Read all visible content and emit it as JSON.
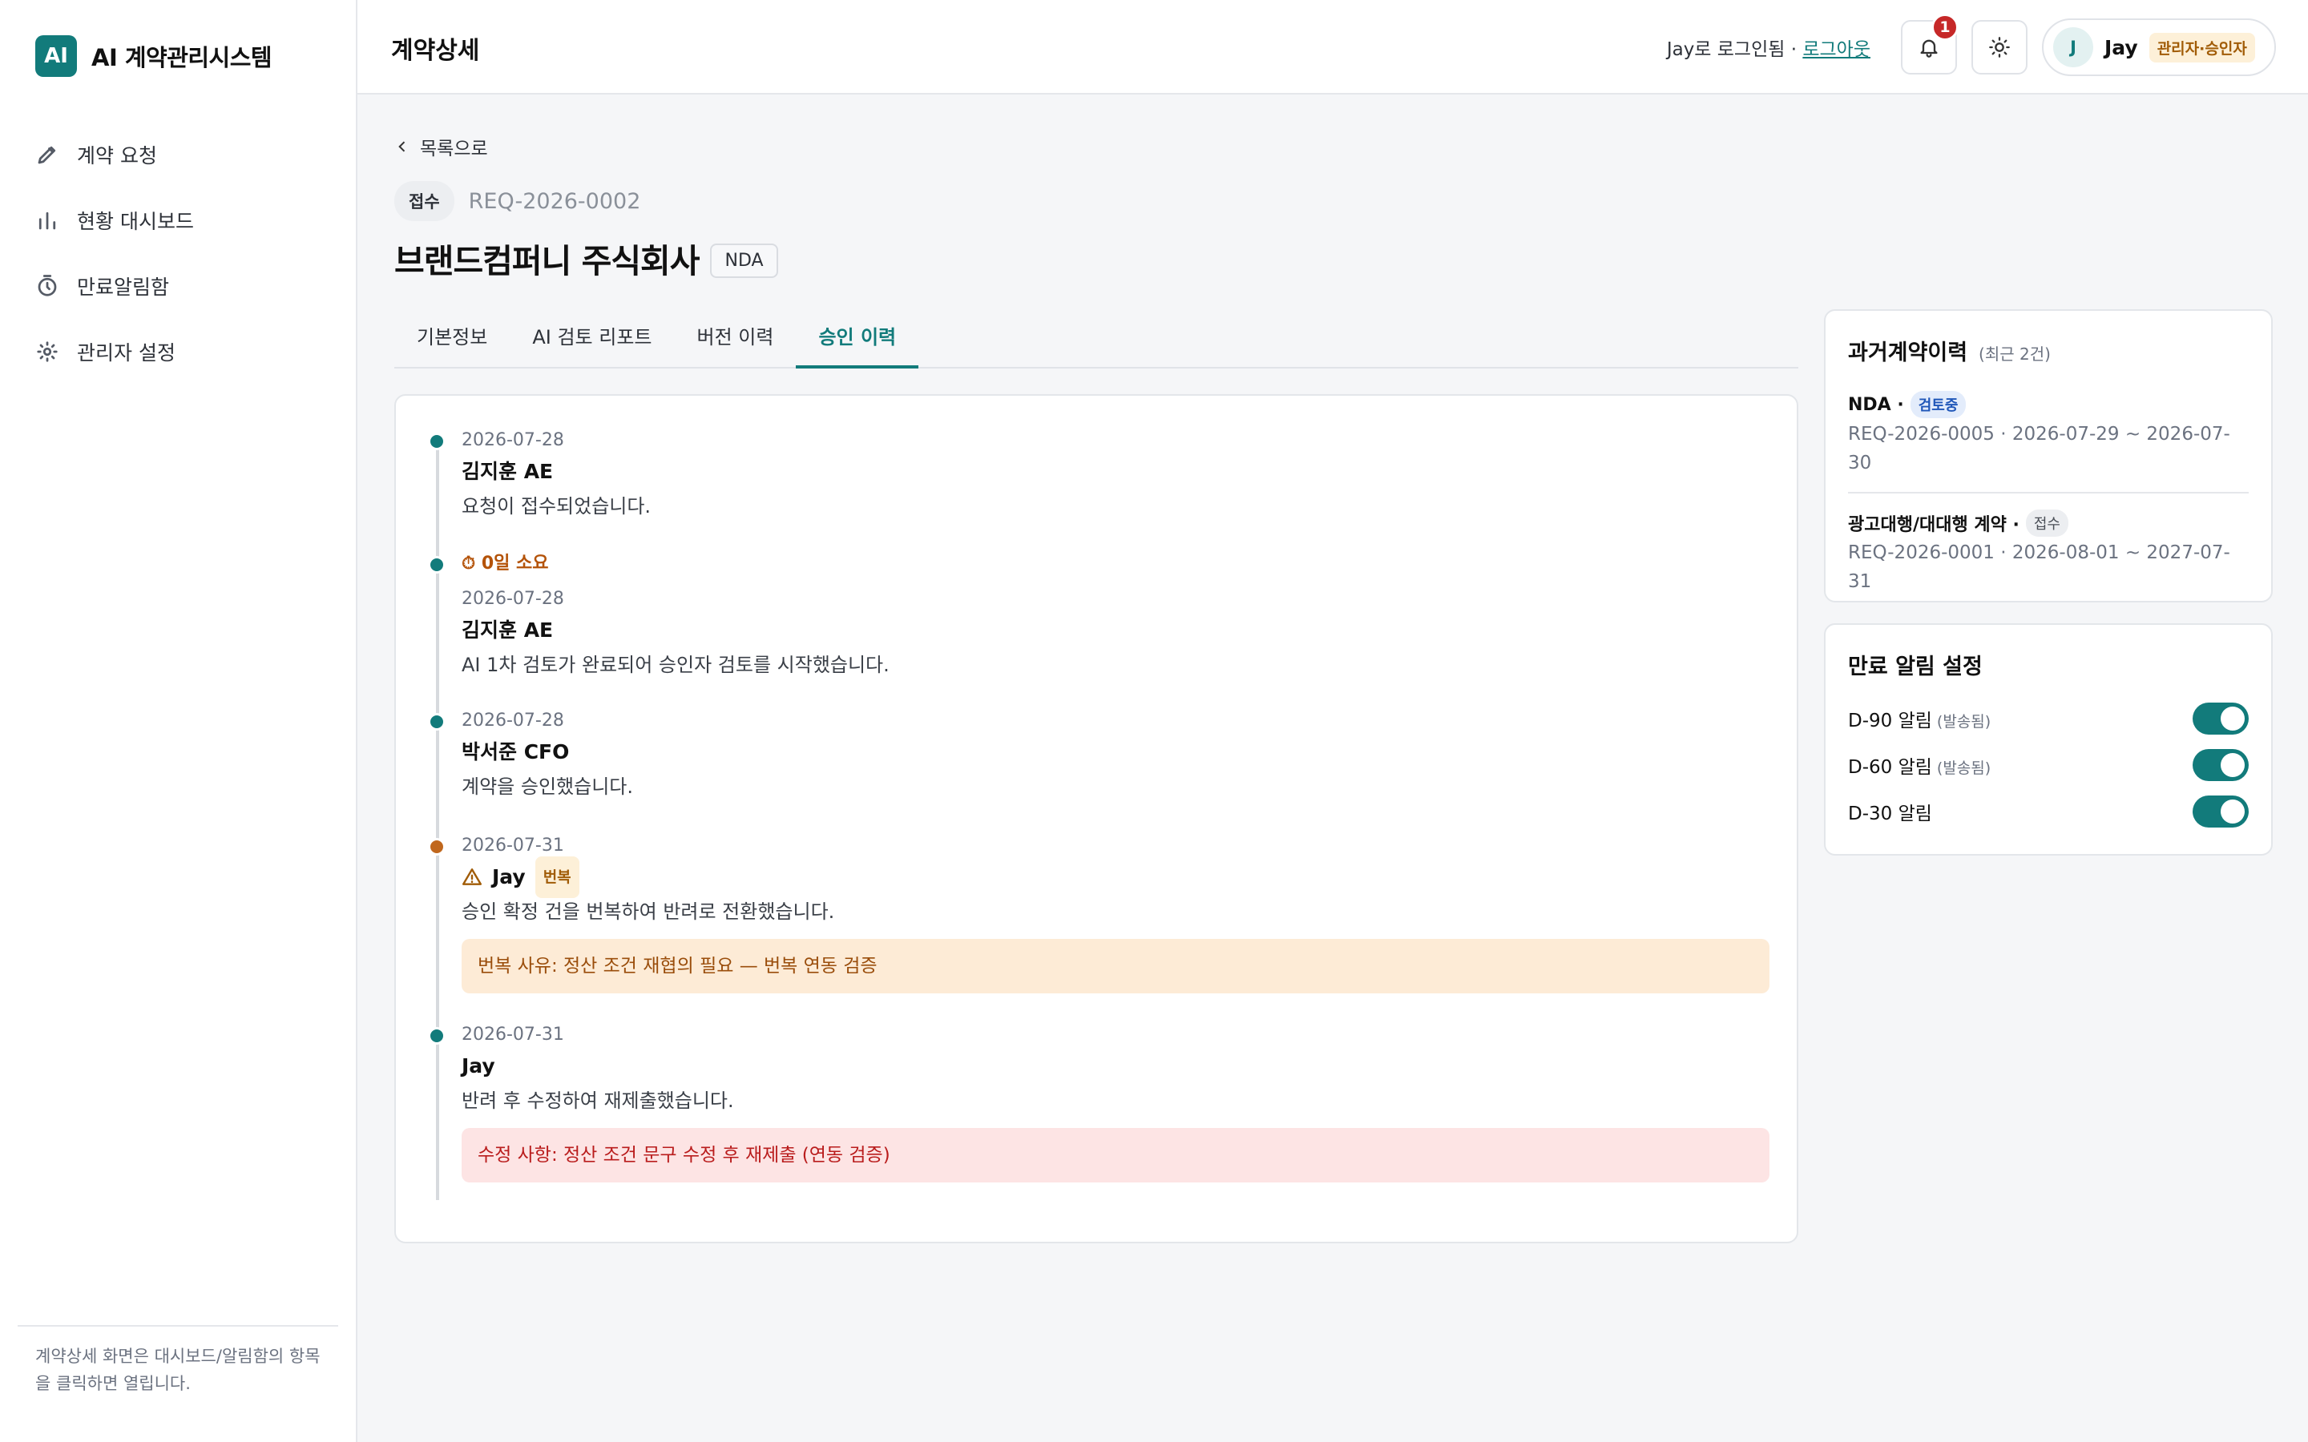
{
  "brand": {
    "logo": "AI",
    "name": "AI 계약관리시스템"
  },
  "sidebar": {
    "items": [
      {
        "label": "계약 요청",
        "icon": "pencil-icon"
      },
      {
        "label": "현황 대시보드",
        "icon": "bar-chart-icon"
      },
      {
        "label": "만료알림함",
        "icon": "timer-icon"
      },
      {
        "label": "관리자 설정",
        "icon": "sun-gear-icon"
      }
    ],
    "footer": "계약상세 화면은 대시보드/알림함의 항목을 클릭하면 열립니다."
  },
  "topbar": {
    "title": "계약상세",
    "login_text": "Jay로 로그인됨 · ",
    "logout_label": "로그아웃",
    "notification_count": "1",
    "user": {
      "initial": "J",
      "name": "Jay",
      "role": "관리자·승인자"
    }
  },
  "main": {
    "back_label": "목록으로",
    "status": "접수",
    "request_id": "REQ-2026-0002",
    "title": "브랜드컴퍼니 주식회사",
    "type_tag": "NDA",
    "tabs": [
      {
        "label": "기본정보",
        "active": false
      },
      {
        "label": "AI 검토 리포트",
        "active": false
      },
      {
        "label": "버전 이력",
        "active": false
      },
      {
        "label": "승인 이력",
        "active": true
      }
    ]
  },
  "timeline": [
    {
      "date": "2026-07-28",
      "actor": "김지훈 AE",
      "message": "요청이 접수되었습니다."
    },
    {
      "duration": "⏱ 0일 소요",
      "date": "2026-07-28",
      "actor": "김지훈 AE",
      "message": "AI 1차 검토가 완료되어 승인자 검토를 시작했습니다."
    },
    {
      "date": "2026-07-28",
      "actor": "박서준 CFO",
      "message": "계약을 승인했습니다."
    },
    {
      "date": "2026-07-31",
      "actor": "Jay",
      "badge": "번복",
      "message": "승인 확정 건을 번복하여 반려로 전환했습니다.",
      "note": "번복 사유: 정산 조건 재협의 필요 — 번복 연동 검증"
    },
    {
      "date": "2026-07-31",
      "actor": "Jay",
      "message": "반려 후 수정하여 재제출했습니다.",
      "note": "수정 사항: 정산 조건 문구 수정 후 재제출 (연동 검증)"
    }
  ],
  "past_contracts": {
    "title": "과거계약이력",
    "subtitle": "(최근 2건)",
    "items": [
      {
        "name": "NDA ·",
        "state": "검토중",
        "detail": "REQ-2026-0005 · 2026-07-29 ~ 2026-07-30"
      },
      {
        "name": "광고대행/대대행 계약 ·",
        "state": "접수",
        "detail": "REQ-2026-0001 · 2026-08-01 ~ 2027-07-31"
      }
    ]
  },
  "expiry_alerts": {
    "title": "만료 알림 설정",
    "items": [
      {
        "label": "D-90 알림",
        "sent": "(발송됨)",
        "enabled": true
      },
      {
        "label": "D-60 알림",
        "sent": "(발송됨)",
        "enabled": true
      },
      {
        "label": "D-30 알림",
        "sent": "",
        "enabled": true
      }
    ]
  },
  "colors": {
    "accent": "#127b7b",
    "warning": "#c0671d",
    "danger": "#b91c1c"
  }
}
